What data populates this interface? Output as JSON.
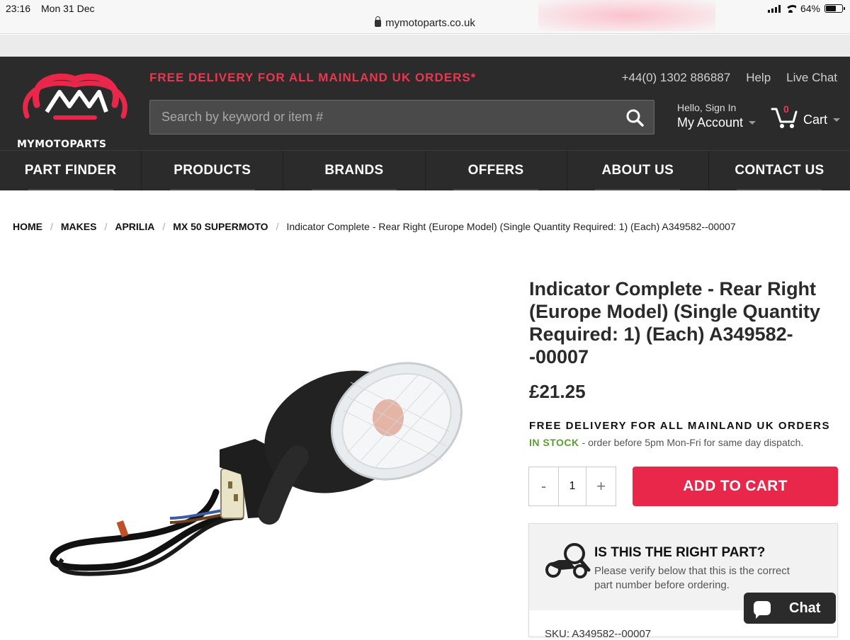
{
  "status_bar": {
    "time": "23:16",
    "date": "Mon 31 Dec",
    "url": "mymotoparts.co.uk",
    "battery": "64%",
    "battery_level": 0.64
  },
  "header": {
    "logo_text": "MYMOTOPARTS",
    "promo": "FREE DELIVERY FOR ALL MAINLAND UK ORDERS*",
    "phone": "+44(0) 1302 886887",
    "help": "Help",
    "live_chat": "Live Chat",
    "search_placeholder": "Search by keyword or item #",
    "account_greeting": "Hello, Sign In",
    "account_label": "My Account",
    "cart_count": "0",
    "cart_label": "Cart"
  },
  "nav": [
    "PART FINDER",
    "PRODUCTS",
    "BRANDS",
    "OFFERS",
    "ABOUT US",
    "CONTACT US"
  ],
  "breadcrumb": {
    "items": [
      "HOME",
      "MAKES",
      "APRILIA",
      "MX 50 SUPERMOTO"
    ],
    "current": "Indicator Complete - Rear Right (Europe Model) (Single Quantity Required: 1) (Each) A349582--00007"
  },
  "product": {
    "title": "Indicator Complete - Rear Right (Europe Model) (Single Quantity Required: 1) (Each) A349582--00007",
    "price": "£21.25",
    "delivery": "FREE DELIVERY FOR ALL MAINLAND UK ORDERS",
    "stock_status": "IN STOCK",
    "stock_note": " - order before 5pm Mon-Fri for same day dispatch.",
    "qty_minus": "-",
    "qty_value": "1",
    "qty_plus": "+",
    "add_to_cart": "ADD TO CART"
  },
  "right_part": {
    "heading": "IS THIS THE RIGHT PART?",
    "description": "Please verify below that this is the correct part number before ordering.",
    "sku": "SKU: A349582--00007"
  },
  "chat_widget": {
    "label": "Chat"
  },
  "colors": {
    "brand_red": "#e8274a",
    "header_dark": "#2b2b2b",
    "stock_green": "#5aa02c"
  }
}
